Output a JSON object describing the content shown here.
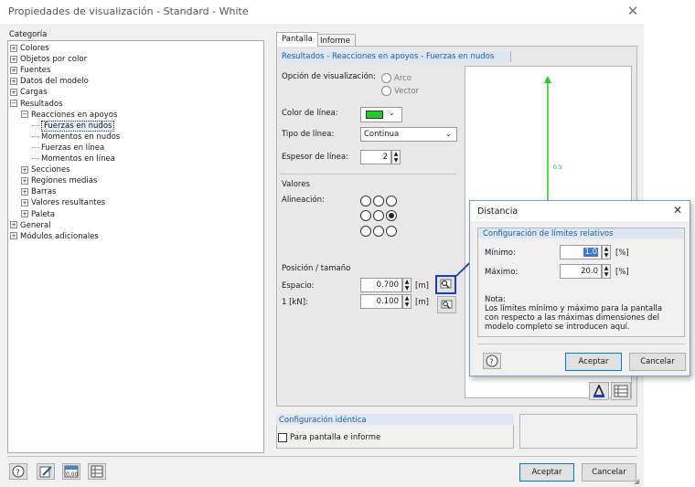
{
  "window": {
    "title": "Propiedades de visualización - Standard - White",
    "close_symbol": "✕"
  },
  "category": {
    "label": "Categoría",
    "tree": [
      {
        "label": "Colores",
        "level": 0,
        "expander": "+"
      },
      {
        "label": "Objetos por color",
        "level": 0,
        "expander": "+"
      },
      {
        "label": "Fuentes",
        "level": 0,
        "expander": "+"
      },
      {
        "label": "Datos del modelo",
        "level": 0,
        "expander": "+"
      },
      {
        "label": "Cargas",
        "level": 0,
        "expander": "+"
      },
      {
        "label": "Resultados",
        "level": 0,
        "expander": "−"
      },
      {
        "label": "Reacciones en apoyos",
        "level": 1,
        "expander": "−"
      },
      {
        "label": "Fuerzas en nudos",
        "level": 2,
        "expander": "",
        "selected": true
      },
      {
        "label": "Momentos en nudos",
        "level": 2,
        "expander": ""
      },
      {
        "label": "Fuerzas en línea",
        "level": 2,
        "expander": ""
      },
      {
        "label": "Momentos en línea",
        "level": 2,
        "expander": ""
      },
      {
        "label": "Secciones",
        "level": 1,
        "expander": "+"
      },
      {
        "label": "Regiones medias",
        "level": 1,
        "expander": "+"
      },
      {
        "label": "Barras",
        "level": 1,
        "expander": "+"
      },
      {
        "label": "Valores resultantes",
        "level": 1,
        "expander": "+"
      },
      {
        "label": "Paleta",
        "level": 1,
        "expander": "+"
      },
      {
        "label": "General",
        "level": 0,
        "expander": "+"
      },
      {
        "label": "Módulos adicionales",
        "level": 0,
        "expander": "+"
      }
    ]
  },
  "tabs": [
    {
      "label": "Pantalla",
      "active": true
    },
    {
      "label": "Informe",
      "active": false
    }
  ],
  "panel": {
    "section_title": "Resultados - Reacciones en apoyos - Fuerzas en nudos",
    "display_option_label": "Opción de visualización:",
    "display_options": [
      "Arco",
      "Vector"
    ],
    "line_color_label": "Color de línea:",
    "line_color": "#22cc22",
    "line_type_label": "Tipo de línea:",
    "line_type_value": "Continua",
    "line_width_label": "Espesor de línea:",
    "line_width_value": "2",
    "values_label": "Valores",
    "alignment_label": "Alineación:",
    "alignment_selected": "middle-right",
    "position_size_label": "Posición / tamaño",
    "spacing_label": "Espacio:",
    "spacing_value": "0.700",
    "spacing_unit": "[m]",
    "kn_label": "1 [kN]:",
    "kn_value": "0.100",
    "kn_unit": "[m]",
    "preview_value": "0.5"
  },
  "identical": {
    "section_title": "Configuración idéntica",
    "checkbox_label": "Para pantalla e informe",
    "checked": false
  },
  "footer": {
    "accept_label": "Aceptar",
    "cancel_label": "Cancelar"
  },
  "subdialog": {
    "title": "Distancia",
    "close_symbol": "✕",
    "section_title": "Configuración de límites relativos",
    "min_label": "Mínimo:",
    "min_value": "1.0",
    "max_label": "Máximo:",
    "max_value": "20.0",
    "unit": "[%]",
    "note_title": "Nota:",
    "note_text": "Los límites mínimo y máximo para la pantalla con respecto a las máximas dimensiones del modelo completo se introducen aquí.",
    "accept_label": "Aceptar",
    "cancel_label": "Cancelar"
  },
  "colors": {
    "accent_blue": "#1f5fa8",
    "highlight_border": "#1a3fb0",
    "line_green": "#22cc22"
  }
}
